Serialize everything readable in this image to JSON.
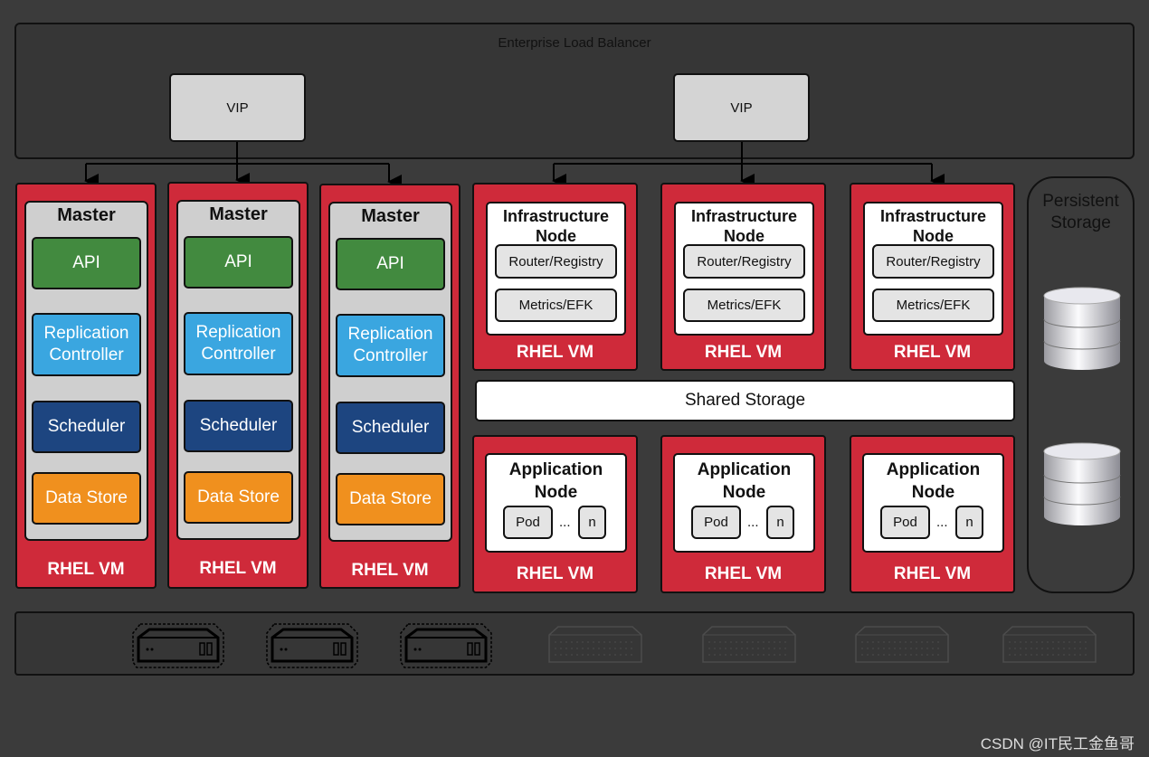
{
  "load_balancer": {
    "title": "Enterprise Load Balancer",
    "vips": [
      "VIP",
      "VIP"
    ]
  },
  "masters": [
    {
      "title": "Master",
      "components": [
        "API",
        "Replication Controller",
        "Scheduler",
        "Data Store"
      ],
      "vm_label": "RHEL VM"
    },
    {
      "title": "Master",
      "components": [
        "API",
        "Replication Controller",
        "Scheduler",
        "Data Store"
      ],
      "vm_label": "RHEL VM"
    },
    {
      "title": "Master",
      "components": [
        "API",
        "Replication Controller",
        "Scheduler",
        "Data Store"
      ],
      "vm_label": "RHEL VM"
    }
  ],
  "infra_nodes": [
    {
      "title": "Infrastructure Node",
      "services": [
        "Router/Registry",
        "Metrics/EFK"
      ],
      "vm_label": "RHEL VM"
    },
    {
      "title": "Infrastructure Node",
      "services": [
        "Router/Registry",
        "Metrics/EFK"
      ],
      "vm_label": "RHEL VM"
    },
    {
      "title": "Infrastructure Node",
      "services": [
        "Router/Registry",
        "Metrics/EFK"
      ],
      "vm_label": "RHEL VM"
    }
  ],
  "shared_storage": "Shared Storage",
  "app_nodes": [
    {
      "title": "Application Node",
      "pod": "Pod",
      "ellipsis": "...",
      "n": "n",
      "vm_label": "RHEL VM"
    },
    {
      "title": "Application Node",
      "pod": "Pod",
      "ellipsis": "...",
      "n": "n",
      "vm_label": "RHEL VM"
    },
    {
      "title": "Application Node",
      "pod": "Pod",
      "ellipsis": "...",
      "n": "n",
      "vm_label": "RHEL VM"
    }
  ],
  "persistent_storage": {
    "title": "Persistent Storage",
    "icons": [
      "database-icon",
      "database-icon"
    ]
  },
  "hardware": {
    "active_servers": 3,
    "inactive_servers": 4
  },
  "colors": {
    "vm_red": "#cf2a3a",
    "api": "#428a3f",
    "replication_controller": "#3aa6e0",
    "scheduler": "#1d4580",
    "data_store": "#f0901e"
  },
  "watermark": "CSDN @IT民工金鱼哥"
}
